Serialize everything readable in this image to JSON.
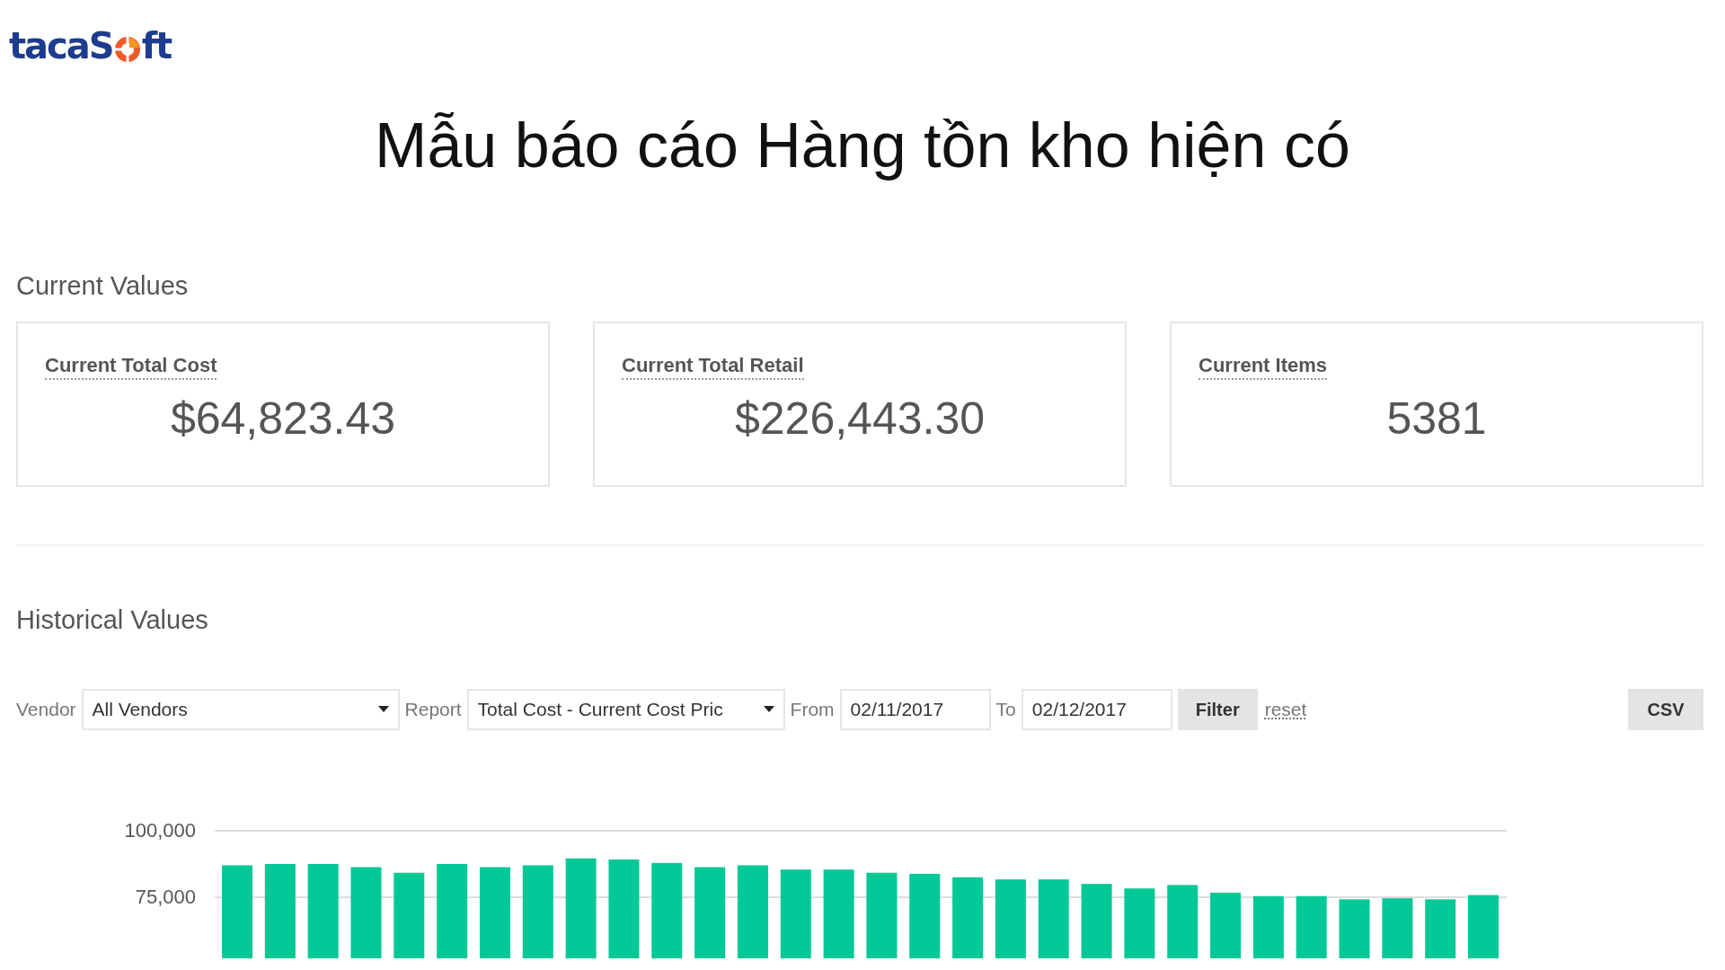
{
  "logo": {
    "text_start": "tacaS",
    "text_end": "ft"
  },
  "title": "Mẫu báo cáo Hàng tồn kho hiện có",
  "current_values": {
    "heading": "Current Values",
    "cards": [
      {
        "label": "Current Total Cost",
        "value": "$64,823.43"
      },
      {
        "label": "Current Total Retail",
        "value": "$226,443.30"
      },
      {
        "label": "Current Items",
        "value": "5381"
      }
    ]
  },
  "historical_values": {
    "heading": "Historical Values",
    "filters": {
      "vendor_label": "Vendor",
      "vendor_value": "All Vendors",
      "report_label": "Report",
      "report_value": "Total Cost - Current Cost Pric",
      "from_label": "From",
      "from_value": "02/11/2017",
      "to_label": "To",
      "to_value": "02/12/2017",
      "filter_button": "Filter",
      "reset_link": "reset",
      "csv_button": "CSV"
    },
    "chart_data": {
      "type": "bar",
      "ylim": [
        52000,
        100000
      ],
      "yticks": [
        {
          "value": 75000,
          "label": "75,000"
        },
        {
          "value": 100000,
          "label": "100,000"
        }
      ],
      "series": [
        {
          "color": "#00c896",
          "values": [
            87000,
            87500,
            87500,
            86300,
            84200,
            87500,
            86300,
            87000,
            89600,
            89200,
            87900,
            86300,
            87000,
            85400,
            85400,
            84200,
            83800,
            82500,
            81700,
            81700,
            80000,
            78300,
            79600,
            76700,
            75400,
            75400,
            74200,
            74600,
            74200,
            75800
          ]
        }
      ]
    }
  }
}
